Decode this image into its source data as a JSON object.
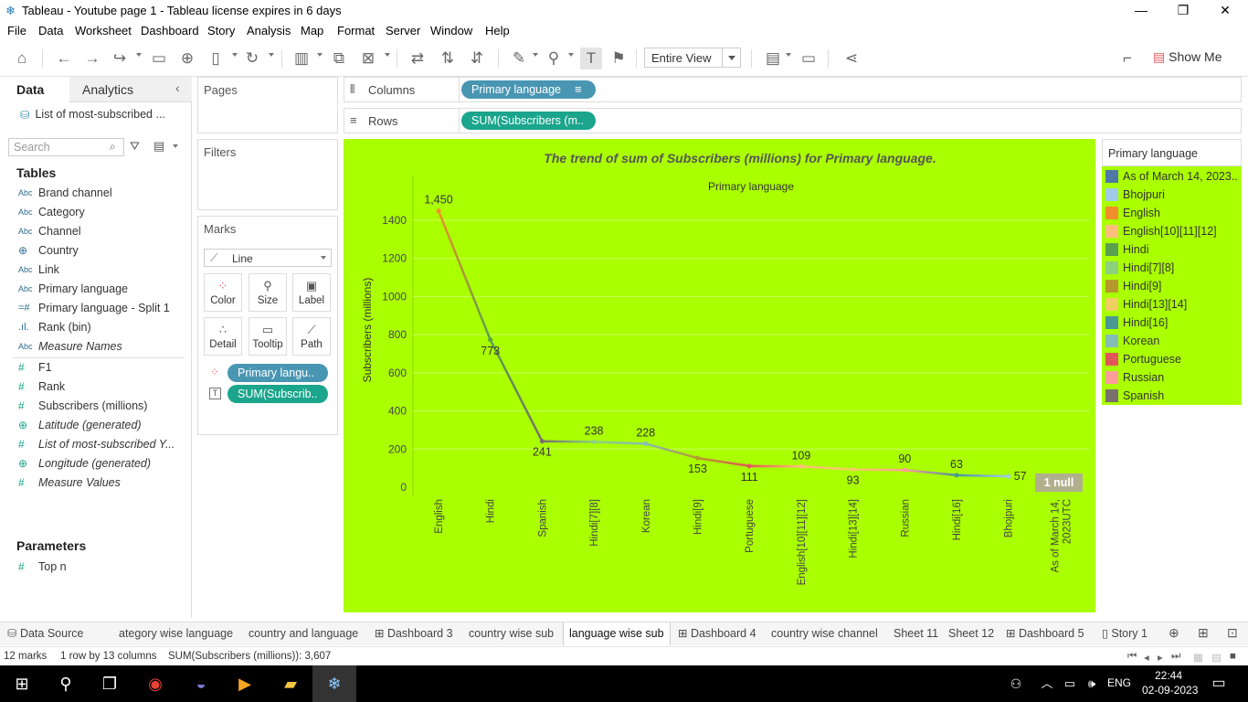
{
  "window": {
    "title": "Tableau - Youtube page 1 - Tableau license expires in 6 days"
  },
  "menu": [
    "File",
    "Data",
    "Worksheet",
    "Dashboard",
    "Story",
    "Analysis",
    "Map",
    "Format",
    "Server",
    "Window",
    "Help"
  ],
  "toolbar": {
    "fit": "Entire View",
    "show_me": "Show Me"
  },
  "left_pane": {
    "tab_data": "Data",
    "tab_analytics": "Analytics",
    "datasource": "List of most-subscribed ...",
    "search_placeholder": "Search",
    "tables_header": "Tables",
    "dimensions": [
      {
        "icon": "Abc",
        "label": "Brand channel"
      },
      {
        "icon": "Abc",
        "label": "Category"
      },
      {
        "icon": "Abc",
        "label": "Channel"
      },
      {
        "icon": "globe",
        "label": "Country"
      },
      {
        "icon": "Abc",
        "label": "Link"
      },
      {
        "icon": "Abc",
        "label": "Primary language"
      },
      {
        "icon": "split",
        "label": "Primary language - Split 1"
      },
      {
        "icon": "bin",
        "label": "Rank (bin)"
      },
      {
        "icon": "Abc",
        "label": "Measure Names"
      }
    ],
    "measures": [
      {
        "icon": "#",
        "label": "F1"
      },
      {
        "icon": "#",
        "label": "Rank"
      },
      {
        "icon": "#",
        "label": "Subscribers (millions)"
      },
      {
        "icon": "globe",
        "label": "Latitude (generated)"
      },
      {
        "icon": "#",
        "label": "List of most-subscribed Y..."
      },
      {
        "icon": "globe",
        "label": "Longitude (generated)"
      },
      {
        "icon": "#",
        "label": "Measure Values"
      }
    ],
    "parameters_header": "Parameters",
    "parameters": [
      {
        "icon": "#",
        "label": "Top n"
      }
    ]
  },
  "shelves": {
    "pages": "Pages",
    "filters": "Filters",
    "marks": "Marks",
    "mark_type": "Line",
    "cards": [
      "Color",
      "Size",
      "Label",
      "Detail",
      "Tooltip",
      "Path"
    ],
    "mark_pills": [
      "Primary langu..",
      "SUM(Subscrib.."
    ],
    "columns_label": "Columns",
    "columns_pill": "Primary language",
    "rows_label": "Rows",
    "rows_pill": "SUM(Subscribers (m.."
  },
  "chart_data": {
    "type": "line",
    "title": "The trend of sum of Subscribers (millions) for Primary language.",
    "xlabel": "Primary language",
    "ylabel": "Subscribers (millions)",
    "ylim": [
      0,
      1500
    ],
    "yticks": [
      0,
      200,
      400,
      600,
      800,
      1000,
      1200,
      1400
    ],
    "categories": [
      "English",
      "Hindi",
      "Spanish",
      "Hindi[7][8]",
      "Korean",
      "Hindi[9]",
      "Portuguese",
      "English[10][11][12]",
      "Hindi[13][14]",
      "Russian",
      "Hindi[16]",
      "Bhojpuri",
      "As of March 14, 2023UTC"
    ],
    "values": [
      1450,
      773,
      241,
      238,
      228,
      153,
      111,
      109,
      93,
      90,
      63,
      57,
      null
    ],
    "data_labels": [
      "1,450",
      "773",
      "241",
      "238",
      "228",
      "153",
      "111",
      "109",
      "93",
      "90",
      "63",
      "57",
      ""
    ],
    "null_badge": "1 null",
    "grid": true,
    "background": "#aaff00"
  },
  "legend": {
    "title": "Primary language",
    "items": [
      {
        "label": "As of March 14, 2023..",
        "color": "#4e79a7"
      },
      {
        "label": "Bhojpuri",
        "color": "#a0cbe8"
      },
      {
        "label": "English",
        "color": "#f28e2b"
      },
      {
        "label": "English[10][11][12]",
        "color": "#ffbe7d"
      },
      {
        "label": "Hindi",
        "color": "#59a14f"
      },
      {
        "label": "Hindi[7][8]",
        "color": "#8cd17d"
      },
      {
        "label": "Hindi[9]",
        "color": "#b6992d"
      },
      {
        "label": "Hindi[13][14]",
        "color": "#f1ce63"
      },
      {
        "label": "Hindi[16]",
        "color": "#499894"
      },
      {
        "label": "Korean",
        "color": "#86bcb6"
      },
      {
        "label": "Portuguese",
        "color": "#e15759"
      },
      {
        "label": "Russian",
        "color": "#ff9d9a"
      },
      {
        "label": "Spanish",
        "color": "#79706e"
      }
    ]
  },
  "sheet_tabs": [
    "Data Source",
    "ategory wise  language",
    "country and language",
    "Dashboard 3",
    "country wise sub",
    "language wise sub",
    "Dashboard 4",
    "country wise channel",
    "Sheet 11",
    "Sheet 12",
    "Dashboard 5",
    "Story 1"
  ],
  "status": {
    "marks": "12 marks",
    "dims": "1 row by 13 columns",
    "sum": "SUM(Subscribers (millions)): 3,607"
  },
  "taskbar": {
    "lang": "ENG",
    "time": "22:44",
    "date": "02-09-2023"
  }
}
